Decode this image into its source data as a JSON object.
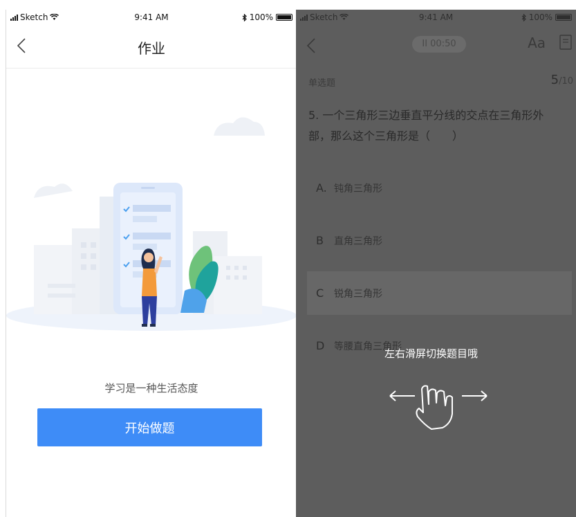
{
  "left_screen": {
    "status": {
      "carrier": "Sketch",
      "time": "9:41 AM",
      "battery": "100%"
    },
    "title": "作业",
    "motto": "学习是一种生活态度",
    "start_button": "开始做题"
  },
  "right_screen": {
    "status": {
      "carrier": "Sketch",
      "time": "9:41 AM",
      "battery": "100%"
    },
    "timer": "II 00:50",
    "font_button": "Aa",
    "question_type": "单选题",
    "progress_current": "5",
    "progress_total": "/10",
    "question": "5. 一个三角形三边垂直平分线的交点在三角形外部，那么这个三角形是（　　）",
    "options": [
      {
        "letter": "A.",
        "text": "钝角三角形"
      },
      {
        "letter": "B",
        "text": "直角三角形"
      },
      {
        "letter": "C",
        "text": "锐角三角形"
      },
      {
        "letter": "D",
        "text": "等腰直角三角形"
      }
    ],
    "selected_option": "C",
    "swipe_hint": "左右滑屏切换题目哦"
  },
  "colors": {
    "primary_button": "#3e8cf7",
    "overlay": "#5d5d5d"
  },
  "icons": [
    "back-icon",
    "wifi-icon",
    "signal-icon",
    "bluetooth-icon",
    "battery-icon",
    "answer-sheet-icon",
    "swipe-hand-icon"
  ]
}
